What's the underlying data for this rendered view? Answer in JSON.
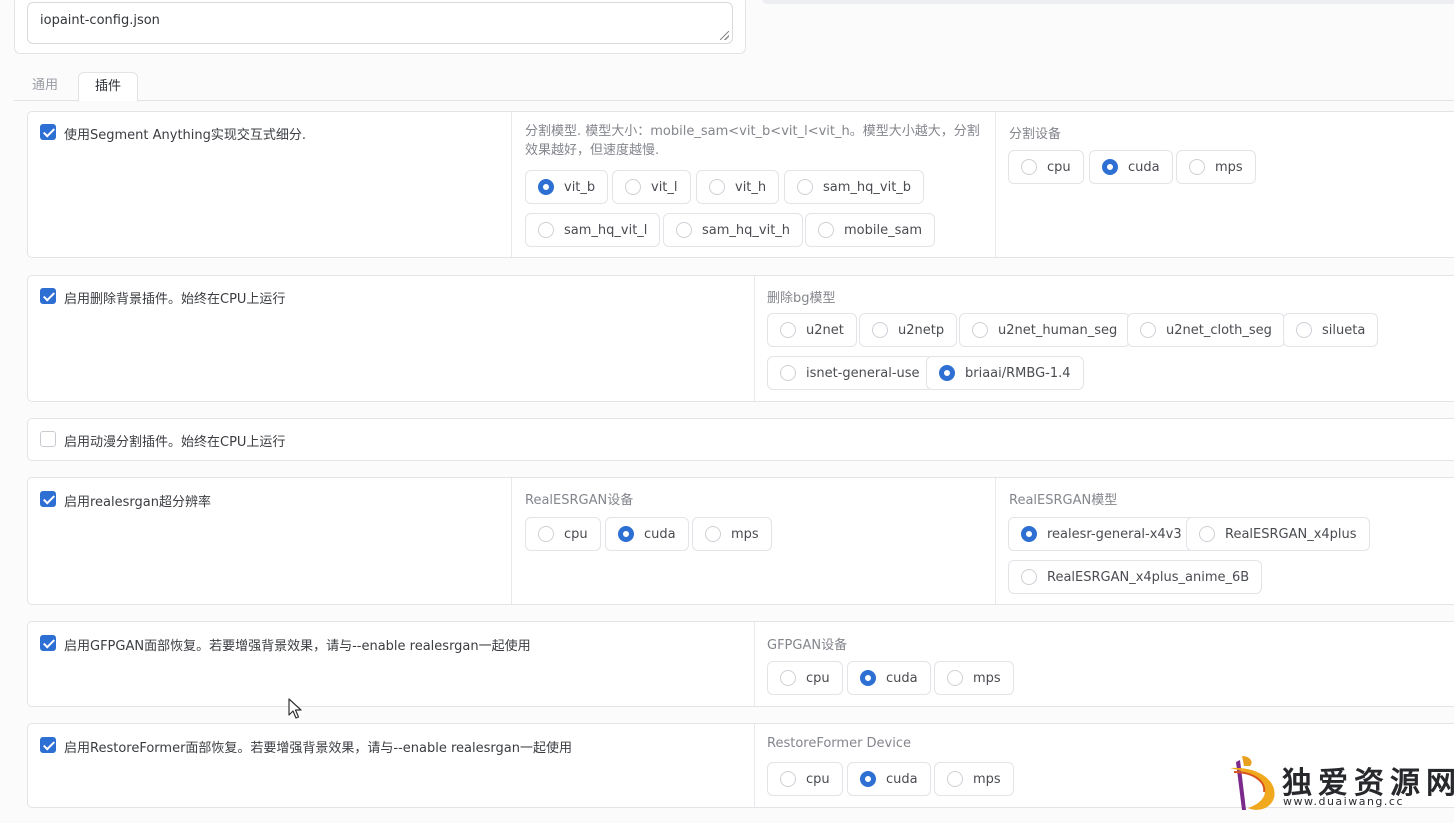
{
  "config": {
    "filename": "iopaint-config.json"
  },
  "tabs": [
    {
      "label": "通用",
      "active": false
    },
    {
      "label": "插件",
      "active": true
    }
  ],
  "sam": {
    "enable_label": "使用Segment Anything实现交互式细分.",
    "enabled": true,
    "model_label": "分割模型. 模型大小：mobile_sam<vit_b<vit_l<vit_h。模型大小越大，分割效果越好，但速度越慢.",
    "models": [
      "vit_b",
      "vit_l",
      "vit_h",
      "sam_hq_vit_b",
      "sam_hq_vit_l",
      "sam_hq_vit_h",
      "mobile_sam"
    ],
    "selected_model": "vit_b",
    "device_label": "分割设备",
    "devices": [
      "cpu",
      "cuda",
      "mps"
    ],
    "selected_device": "cuda"
  },
  "removebg": {
    "enable_label": "启用删除背景插件。始终在CPU上运行",
    "enabled": true,
    "model_label": "删除bg模型",
    "models": [
      "u2net",
      "u2netp",
      "u2net_human_seg",
      "u2net_cloth_seg",
      "silueta",
      "isnet-general-use",
      "briaai/RMBG-1.4"
    ],
    "selected_model": "briaai/RMBG-1.4"
  },
  "anime": {
    "enable_label": "启用动漫分割插件。始终在CPU上运行",
    "enabled": false
  },
  "realesrgan": {
    "enable_label": "启用realesrgan超分辨率",
    "enabled": true,
    "device_label": "RealESRGAN设备",
    "devices": [
      "cpu",
      "cuda",
      "mps"
    ],
    "selected_device": "cuda",
    "model_label": "RealESRGAN模型",
    "models": [
      "realesr-general-x4v3",
      "RealESRGAN_x4plus",
      "RealESRGAN_x4plus_anime_6B"
    ],
    "selected_model": "realesr-general-x4v3"
  },
  "gfpgan": {
    "enable_label": "启用GFPGAN面部恢复。若要增强背景效果，请与--enable realesrgan一起使用",
    "enabled": true,
    "device_label": "GFPGAN设备",
    "devices": [
      "cpu",
      "cuda",
      "mps"
    ],
    "selected_device": "cuda"
  },
  "restoreformer": {
    "enable_label": "启用RestoreFormer面部恢复。若要增强背景效果，请与--enable realesrgan一起使用",
    "enabled": true,
    "device_label": "RestoreFormer Device",
    "devices": [
      "cpu",
      "cuda",
      "mps"
    ],
    "selected_device": "cuda"
  },
  "watermark": {
    "title": "独爱资源网",
    "url": "www.duaiwang.cc"
  },
  "colors": {
    "accent": "#2d6fd2",
    "border": "#e3e4e8",
    "label": "#84868d"
  }
}
